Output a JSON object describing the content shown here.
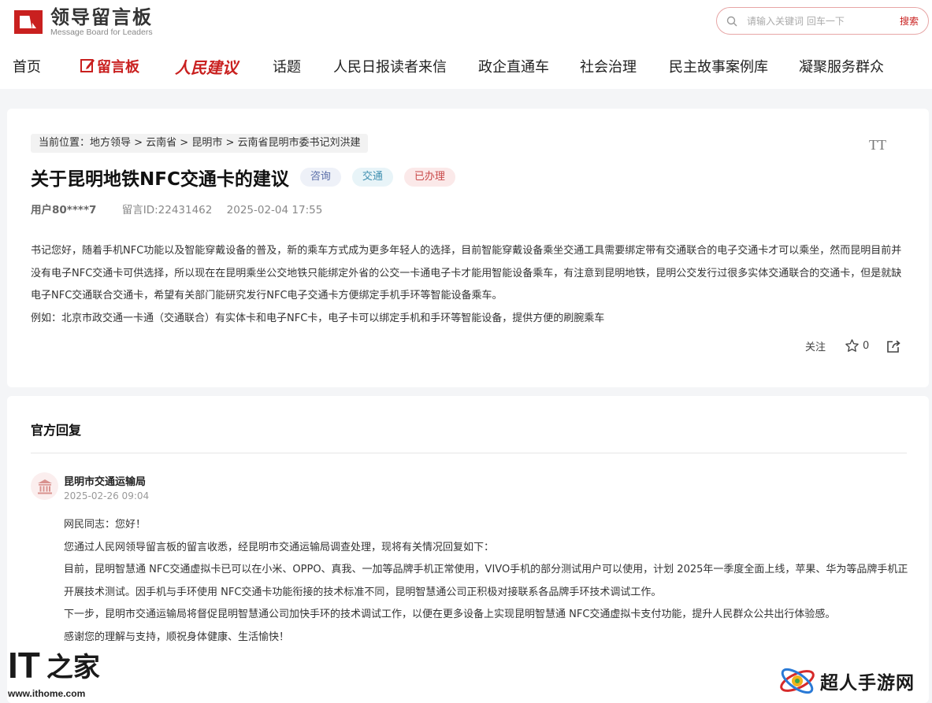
{
  "header": {
    "logo_title": "领导留言板",
    "logo_subtitle": "Message Board for Leaders",
    "search_placeholder": "请输入关键词 回车一下",
    "search_button": "搜索"
  },
  "nav": [
    {
      "label": "首页"
    },
    {
      "label": "留言板"
    },
    {
      "label": "人民建议"
    },
    {
      "label": "话题"
    },
    {
      "label": "人民日报读者来信"
    },
    {
      "label": "政企直通车"
    },
    {
      "label": "社会治理"
    },
    {
      "label": "民主故事案例库"
    },
    {
      "label": "凝聚服务群众"
    }
  ],
  "message": {
    "breadcrumb": "当前位置：地方领导 > 云南省 > 昆明市 > 云南省昆明市委书记刘洪建",
    "font_size_label": "TT",
    "title": "关于昆明地铁NFC交通卡的建议",
    "tags": [
      "咨询",
      "交通",
      "已办理"
    ],
    "user": "用户80****7",
    "message_id": "留言ID:22431462",
    "datetime": "2025-02-04 17:55",
    "paragraphs": [
      "书记您好，随着手机NFC功能以及智能穿戴设备的普及，新的乘车方式成为更多年轻人的选择，目前智能穿戴设备乘坐交通工具需要绑定带有交通联合的电子交通卡才可以乘坐，然而昆明目前并没有电子NFC交通卡可供选择，所以现在在昆明乘坐公交地铁只能绑定外省的公交一卡通电子卡才能用智能设备乘车，有注意到昆明地铁，昆明公交发行过很多实体交通联合的交通卡，但是就缺电子NFC交通联合交通卡，希望有关部门能研究发行NFC电子交通卡方便绑定手机手环等智能设备乘车。",
      "例如：北京市政交通一卡通（交通联合）有实体卡和电子NFC卡，电子卡可以绑定手机和手环等智能设备，提供方便的刷腕乘车"
    ],
    "follow_label": "关注",
    "like_count": "0"
  },
  "reply": {
    "heading": "官方回复",
    "department": "昆明市交通运输局",
    "date": "2025-02-26 09:04",
    "paragraphs": [
      "网民同志：您好！",
      "您通过人民网领导留言板的留言收悉，经昆明市交通运输局调查处理，现将有关情况回复如下：",
      "目前，昆明智慧通 NFC交通虚拟卡已可以在小米、OPPO、真我、一加等品牌手机正常使用，VIVO手机的部分测试用户可以使用，计划 2025年一季度全面上线，苹果、华为等品牌手机正开展技术测试。因手机与手环使用 NFC交通卡功能衔接的技术标准不同，昆明智慧通公司正积极对接联系各品牌手环技术调试工作。",
      "下一步，昆明市交通运输局将督促昆明智慧通公司加快手环的技术调试工作，以便在更多设备上实现昆明智慧通 NFC交通虚拟卡支付功能，提升人民群众公共出行体验感。",
      "感谢您的理解与支持，顺祝身体健康、生活愉快！"
    ]
  },
  "watermarks": {
    "ithome_it": "IT",
    "ithome_home": "之家",
    "ithome_url": "www.ithome.com",
    "chaoren": "超人手游网"
  },
  "colors": {
    "brand_red": "#c9201f",
    "page_bg": "#f4f5f7"
  }
}
